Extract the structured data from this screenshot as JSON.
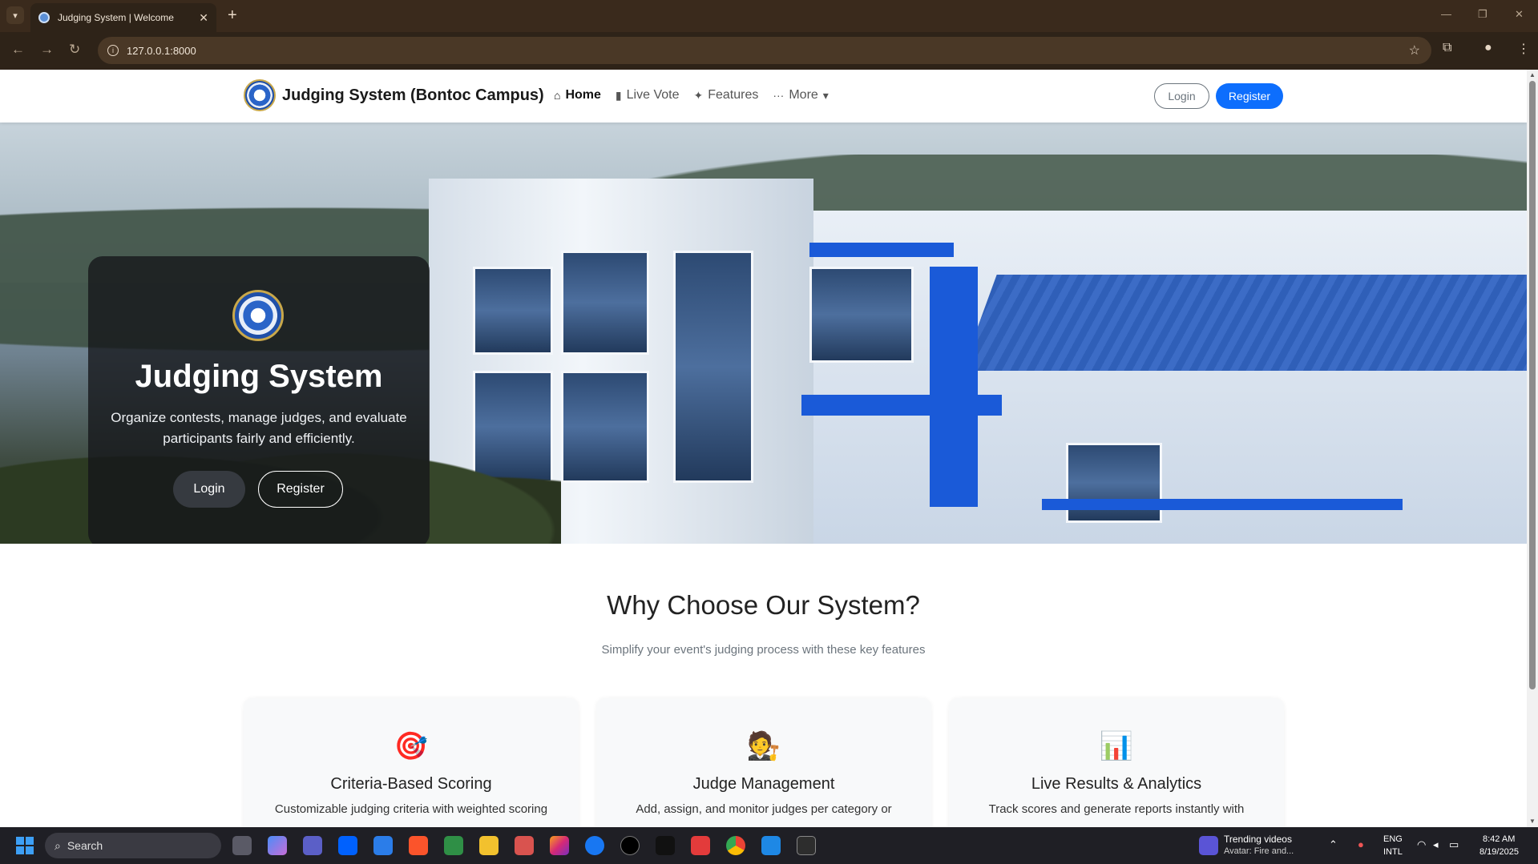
{
  "browser": {
    "tab_title": "Judging System | Welcome",
    "url": "127.0.0.1:8000",
    "new_tab": "+",
    "tab_close": "✕"
  },
  "site": {
    "brand": "Judging System (Bontoc Campus)",
    "nav": [
      {
        "label": "Home",
        "icon": "home-icon"
      },
      {
        "label": "Live Vote",
        "icon": "bar-chart-icon"
      },
      {
        "label": "Features",
        "icon": "sparkles-icon"
      },
      {
        "label": "More",
        "icon": "dots-icon"
      }
    ],
    "login": "Login",
    "register": "Register"
  },
  "hero": {
    "title": "Judging System",
    "subtitle": "Organize contests, manage judges, and evaluate participants fairly and efficiently.",
    "login": "Login",
    "register": "Register"
  },
  "features": {
    "title": "Why Choose Our System?",
    "subtitle": "Simplify your event's judging process with these key features",
    "cards": [
      {
        "emoji": "🎯",
        "title": "Criteria-Based Scoring",
        "desc": "Customizable judging criteria with weighted scoring"
      },
      {
        "emoji": "🧑‍⚖️",
        "title": "Judge Management",
        "desc": "Add, assign, and monitor judges per category or"
      },
      {
        "emoji": "📊",
        "title": "Live Results & Analytics",
        "desc": "Track scores and generate reports instantly with"
      }
    ]
  },
  "taskbar": {
    "search": "Search",
    "notification_title": "Trending videos",
    "notification_sub": "Avatar: Fire and...",
    "lang1": "ENG",
    "lang2": "INTL",
    "time": "8:42 AM",
    "date": "8/19/2025"
  },
  "colors": {
    "accent": "#0d6efd",
    "chrome_bg": "#3a2a1c",
    "hero_card": "#14161a"
  }
}
